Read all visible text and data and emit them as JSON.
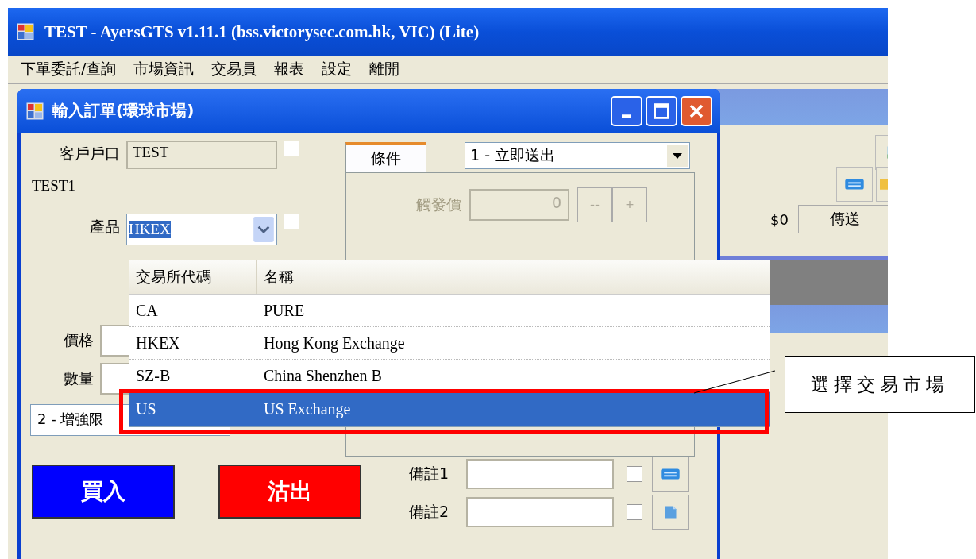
{
  "app_window": {
    "title": "TEST - AyersGTS v1.11.1 (bss.victorysec.com.hk, VIC) (Lite)"
  },
  "menu": [
    {
      "label": "下單委託/查詢"
    },
    {
      "label": "市場資訊"
    },
    {
      "label": "交易員"
    },
    {
      "label": "報表"
    },
    {
      "label": "設定"
    },
    {
      "label": "離開"
    }
  ],
  "side_panel": {
    "amount": "$0",
    "send_button": "傳送"
  },
  "order_window": {
    "title": "輸入訂單(環球市場)",
    "account": {
      "label": "客戶戶口",
      "value": "TEST",
      "checked": false
    },
    "account_name": "TEST1",
    "product": {
      "label": "產品",
      "value": "HKEX",
      "checked": false
    },
    "price": {
      "label": "價格"
    },
    "quantity": {
      "label": "數量"
    },
    "order_type": {
      "value": "2 - 增強限"
    },
    "tabs": [
      {
        "label": "條件",
        "selected": true
      }
    ],
    "condition": {
      "value": "1 - 立即送出"
    },
    "trigger": {
      "label": "觸發價",
      "value": "0",
      "disabled": true,
      "minus": "--",
      "plus": "+"
    },
    "buy_button": "買入",
    "sell_button": "沽出",
    "remarks": [
      {
        "label": "備註1",
        "checked": false
      },
      {
        "label": "備註2",
        "checked": false
      }
    ]
  },
  "dropdown": {
    "columns": [
      "交易所代碼",
      "名稱"
    ],
    "rows": [
      {
        "code": "CA",
        "name": "PURE",
        "selected": false
      },
      {
        "code": "HKEX",
        "name": "Hong Kong Exchange",
        "selected": false
      },
      {
        "code": "SZ-B",
        "name": "China Shenzhen B",
        "selected": false
      },
      {
        "code": "US",
        "name": "US Exchange",
        "selected": true
      }
    ]
  },
  "callout": {
    "text": "選擇交易市場"
  }
}
